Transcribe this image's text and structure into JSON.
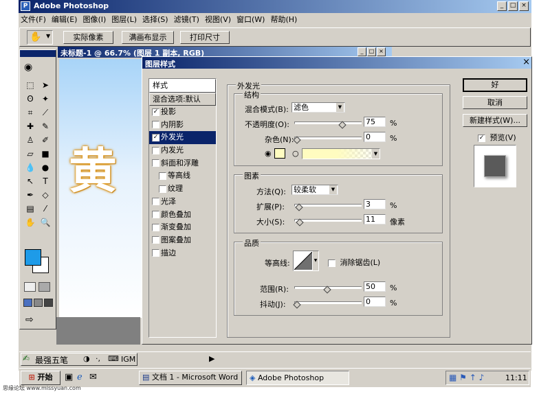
{
  "app": {
    "title": "Adobe Photoshop",
    "win_controls": [
      "_",
      "□",
      "×"
    ],
    "menu": [
      "文件(F)",
      "编辑(E)",
      "图像(I)",
      "图层(L)",
      "选择(S)",
      "滤镜(T)",
      "视图(V)",
      "窗口(W)",
      "帮助(H)"
    ]
  },
  "options_bar": {
    "buttons": [
      "实际像素",
      "满画布显示",
      "打印尺寸"
    ]
  },
  "document": {
    "title": "未标题-1 @ 66.7% (图层 1 副本, RGB)",
    "canvas_text": "黄"
  },
  "dialog": {
    "title": "图层样式",
    "styles_header": "样式",
    "blend_options": "混合选项:默认",
    "effects": [
      {
        "label": "投影",
        "checked": true,
        "indent": false,
        "selected": false
      },
      {
        "label": "内阴影",
        "checked": false,
        "indent": false,
        "selected": false
      },
      {
        "label": "外发光",
        "checked": true,
        "indent": false,
        "selected": true
      },
      {
        "label": "内发光",
        "checked": false,
        "indent": false,
        "selected": false
      },
      {
        "label": "斜面和浮雕",
        "checked": false,
        "indent": false,
        "selected": false
      },
      {
        "label": "等高线",
        "checked": false,
        "indent": true,
        "selected": false
      },
      {
        "label": "纹理",
        "checked": false,
        "indent": true,
        "selected": false
      },
      {
        "label": "光泽",
        "checked": false,
        "indent": false,
        "selected": false
      },
      {
        "label": "颜色叠加",
        "checked": false,
        "indent": false,
        "selected": false
      },
      {
        "label": "渐变叠加",
        "checked": false,
        "indent": false,
        "selected": false
      },
      {
        "label": "图案叠加",
        "checked": false,
        "indent": false,
        "selected": false
      },
      {
        "label": "描边",
        "checked": false,
        "indent": false,
        "selected": false
      }
    ],
    "outer_glow": {
      "title": "外发光",
      "structure": {
        "title": "结构",
        "blend_mode_label": "混合模式(B):",
        "blend_mode_value": "滤色",
        "opacity_label": "不透明度(O):",
        "opacity_value": "75",
        "opacity_unit": "%",
        "opacity_fraction": 0.75,
        "noise_label": "杂色(N):",
        "noise_value": "0",
        "noise_unit": "%",
        "noise_fraction": 0
      },
      "elements": {
        "title": "图素",
        "technique_label": "方法(Q):",
        "technique_value": "较柔软",
        "spread_label": "扩展(P):",
        "spread_value": "3",
        "spread_unit": "%",
        "spread_fraction": 0.03,
        "size_label": "大小(S):",
        "size_value": "11",
        "size_unit": "像素",
        "size_fraction": 0.044
      },
      "quality": {
        "title": "品质",
        "contour_label": "等高线:",
        "antialias_label": "消除锯齿(L)",
        "range_label": "范围(R):",
        "range_value": "50",
        "range_unit": "%",
        "range_fraction": 0.5,
        "jitter_label": "抖动(J):",
        "jitter_value": "0",
        "jitter_unit": "%",
        "jitter_fraction": 0
      }
    },
    "buttons": {
      "ok": "好",
      "cancel": "取消",
      "new_style": "新建样式(W)...",
      "preview": "预览(V)"
    }
  },
  "ime_bar": {
    "name": "最强五笔",
    "extra": "IGM"
  },
  "taskbar": {
    "start": "开始",
    "tasks": [
      "文档 1 - Microsoft Word",
      "Adobe Photoshop"
    ],
    "clock": "11:11"
  },
  "watermark": "思缘论坛 www.missyuan.com",
  "colors": {
    "title_active": "#0a246a",
    "title_gradient_end": "#a6caf0",
    "face": "#d4d0c8",
    "foreground_swatch": "#1e9be8",
    "glow_swatch": "#fffcc0",
    "glyph_gold": "#e8a020"
  }
}
